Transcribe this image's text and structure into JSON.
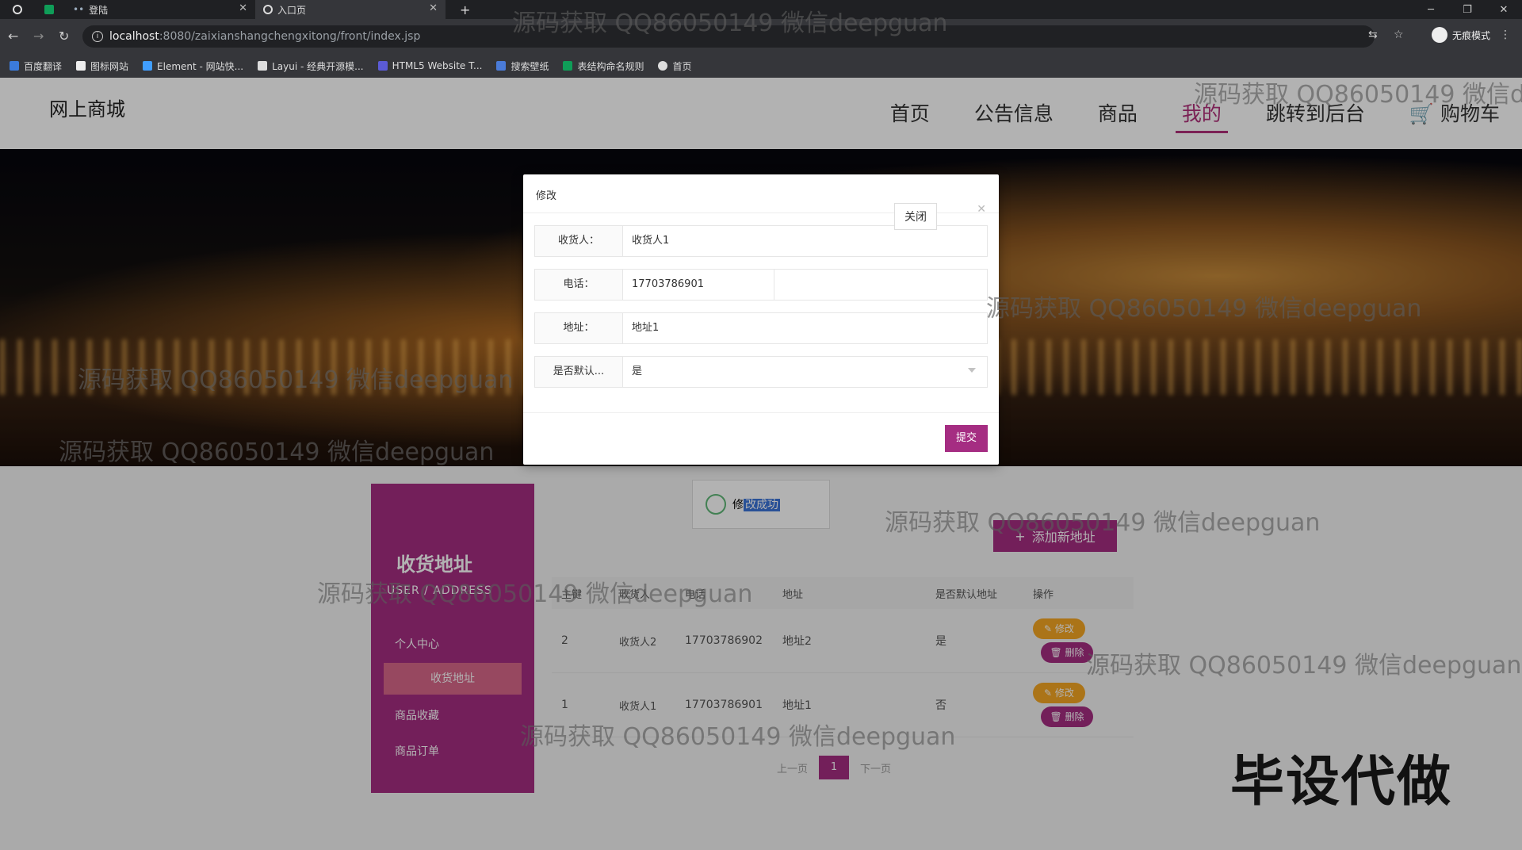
{
  "browser": {
    "tabs": [
      {
        "label": "",
        "active": false
      },
      {
        "label": "登陆",
        "active": false
      },
      {
        "label": "入口页",
        "active": true
      }
    ],
    "new_tab": "+",
    "url_host": "localhost",
    "url_path": ":8080/zaixianshangchengxitong/front/index.jsp",
    "incognito_label": "无痕模式",
    "window_controls": {
      "minimize": "─",
      "restore": "❐",
      "close": "✕"
    },
    "bookmarks": [
      {
        "label": "百度翻译",
        "color": "#3b7bdb"
      },
      {
        "label": "图标网站",
        "color": "#eeeeee"
      },
      {
        "label": "Element - 网站快...",
        "color": "#409eff"
      },
      {
        "label": "Layui - 经典开源模...",
        "color": "#dddddd"
      },
      {
        "label": "HTML5 Website T...",
        "color": "#5b5bd6"
      },
      {
        "label": "搜索壁纸",
        "color": "#4a7bd8"
      },
      {
        "label": "表结构命名规则",
        "color": "#0f9d58"
      },
      {
        "label": "首页",
        "color": "#dddddd"
      }
    ]
  },
  "site": {
    "brand": "网上商城",
    "nav": [
      "首页",
      "公告信息",
      "商品",
      "我的",
      "跳转到后台",
      "购物车"
    ],
    "nav_active": "我的"
  },
  "sidebar": {
    "title": "收货地址",
    "subtitle": "USER / ADDRESS",
    "items": [
      "个人中心",
      "收货地址",
      "商品收藏",
      "商品订单"
    ]
  },
  "tip": {
    "text_prefix": "修",
    "text_selected": "改成功"
  },
  "add_button": "添加新地址",
  "table": {
    "headers": [
      "主键",
      "收货人",
      "电话",
      "地址",
      "是否默认地址",
      "操作"
    ],
    "rows": [
      {
        "id": "2",
        "name": "收货人2",
        "phone": "17703786902",
        "address": "地址2",
        "default": "是"
      },
      {
        "id": "1",
        "name": "收货人1",
        "phone": "17703786901",
        "address": "地址1",
        "default": "否"
      }
    ],
    "edit_label": "修改",
    "delete_label": "删除"
  },
  "pager": {
    "prev": "上一页",
    "current": "1",
    "next": "下一页"
  },
  "overlay_text": "毕设代做",
  "modal": {
    "title": "修改",
    "fields": [
      {
        "label": "收货人：",
        "value": "收货人1"
      },
      {
        "label": "电话：",
        "value": "17703786901"
      },
      {
        "label": "地址：",
        "value": "地址1"
      },
      {
        "label": "是否默认...",
        "value": "是"
      }
    ],
    "close_button": "关闭",
    "submit_button": "提交"
  },
  "watermark": "源码获取 QQ86050149 微信deepguan",
  "colors": {
    "accent": "#a52d82",
    "edit": "#f5a623"
  }
}
